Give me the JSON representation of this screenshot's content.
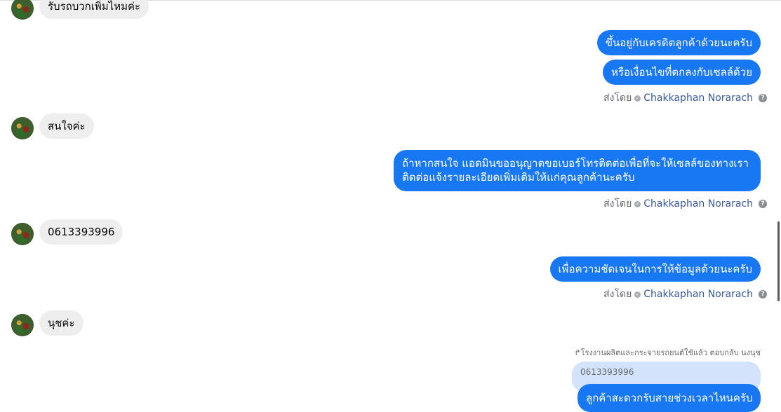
{
  "messages": {
    "m1_in": "รับรถบวกเพิ่มไหมค่ะ",
    "m2_out": "ขึ้นอยู่กับเครดิตลูกค้าด้วยนะครับ",
    "m3_out": "หรือเงื่อนไขที่ตกลงกับเซลล์ด้วย",
    "m4_in": "สนใจค่ะ",
    "m5_out_line1": "ถ้าหากสนใจ แอดมินขออนุญาตขอเบอร์โทรติดต่อเพื่อที่จะให้เซลล์ของทางเรา",
    "m5_out_line2": "ติดต่อแจ้งรายละเอียดเพิ่มเติมให้แก่คุณลูกค้านะครับ",
    "m6_in": "0613393996",
    "m7_out": "เพื่อความชัดเจนในการให้ข้อมูลด้วยนะครับ",
    "m8_in": "นุชค่ะ",
    "reply_note": "โรงงานผลิตและกระจายรถยนต์ใช้แล้ว ตอบกลับ นงนุช",
    "quoted_text": "0613393996",
    "m9_out_partial": "ลูกค้าสะดวกรับสายช่วงเวลาไหนครับ"
  },
  "sent_by": {
    "label": "ส่งโดย",
    "name": "Chakkaphan Norarach",
    "help": "?"
  },
  "colors": {
    "outgoing_bubble": "#1877f2",
    "incoming_bubble": "#eeeeef",
    "quoted_bubble": "#d3e3fb",
    "sender_name": "#385898"
  },
  "icons": {
    "verified": "verified-check-icon",
    "help": "help-circle-icon",
    "reply": "reply-arrow-icon"
  }
}
